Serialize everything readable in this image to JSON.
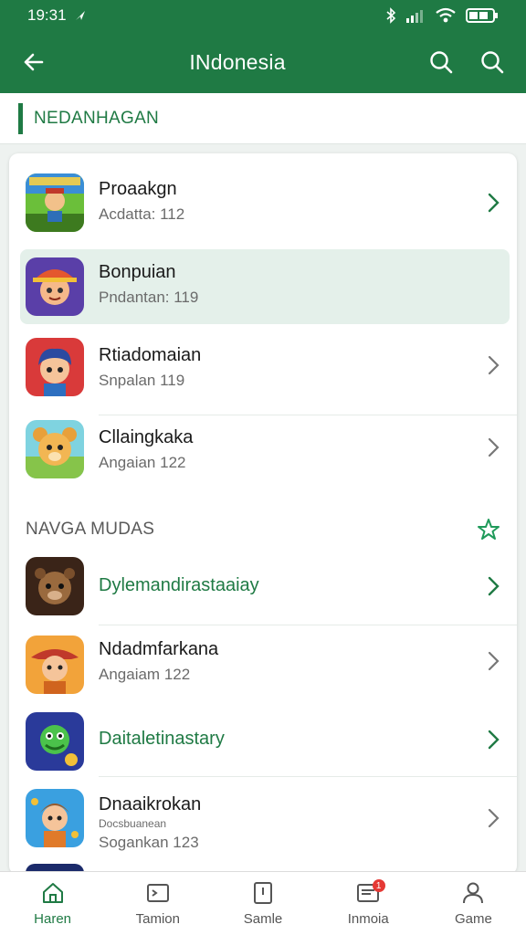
{
  "status": {
    "time": "19:31"
  },
  "toolbar": {
    "title": "INdonesia"
  },
  "section": {
    "label": "NEDANHAGAN"
  },
  "group1": [
    {
      "name": "Proaakgn",
      "sub": "Acdatta: 112",
      "icon": "game-icon-farmer"
    },
    {
      "name": "Bonpuian",
      "sub": "Pndantan: 119",
      "icon": "game-icon-pirate"
    },
    {
      "name": "Rtiadomaian",
      "sub": "Snpalan 119",
      "icon": "game-icon-hero"
    },
    {
      "name": "Cllaingkaka",
      "sub": "Angaian 122",
      "icon": "game-icon-bear"
    }
  ],
  "subsection": {
    "label": "NAVGA MUDAS"
  },
  "group2": [
    {
      "name": "Dylemandirastaaiay",
      "sub": "",
      "icon": "game-icon-monster"
    },
    {
      "name": "Ndadmfarkana",
      "sub": "Angaiam 122",
      "icon": "game-icon-cowboy"
    },
    {
      "name": "Daitaletinastary",
      "sub": "",
      "icon": "game-icon-dino"
    },
    {
      "name": "Dnaaikrokan",
      "sub": "Sogankan 123",
      "sub2": "Docsbuanean",
      "icon": "game-icon-adventurer"
    }
  ],
  "nav": [
    {
      "label": "Haren",
      "icon": "home-icon"
    },
    {
      "label": "Tamion",
      "icon": "terminal-icon"
    },
    {
      "label": "Samle",
      "icon": "book-icon"
    },
    {
      "label": "Inmoia",
      "icon": "inbox-icon",
      "badge": "1"
    },
    {
      "label": "Game",
      "icon": "person-icon"
    }
  ],
  "colors": {
    "primary": "#1f7a44",
    "selected": "#e4f0ea",
    "badge": "#e53935"
  }
}
